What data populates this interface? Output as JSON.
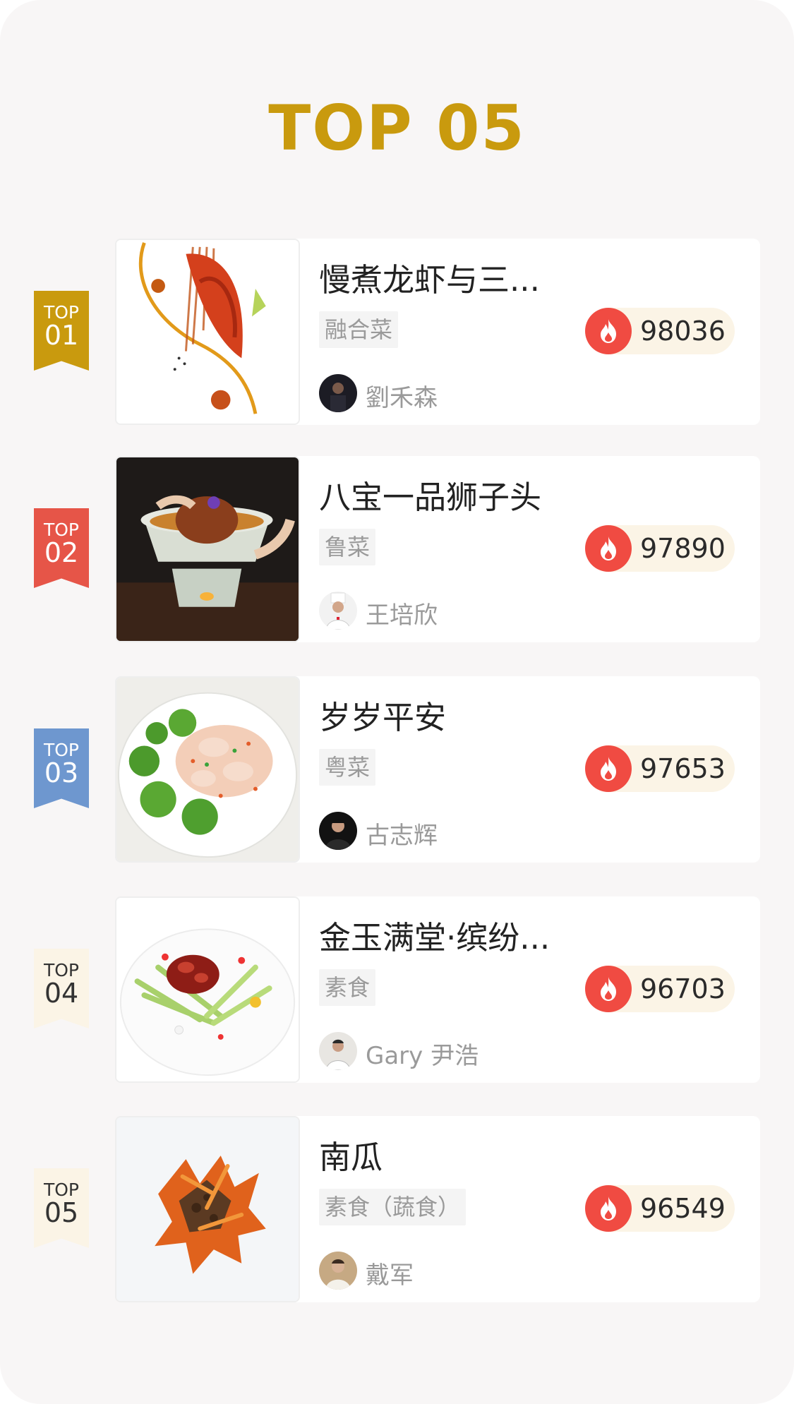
{
  "title": "TOP 05",
  "items": [
    {
      "rank_label": "TOP",
      "rank_no": "01",
      "ribbon_bg": "#c99a0e",
      "ribbon_fg": "#ffffff",
      "dish": "慢煮龙虾与三...",
      "cuisine": "融合菜",
      "chef": "劉禾森",
      "hot": "98036",
      "image": "lobster-dish-image"
    },
    {
      "rank_label": "TOP",
      "rank_no": "02",
      "ribbon_bg": "#e65548",
      "ribbon_fg": "#ffffff",
      "dish": "八宝一品狮子头",
      "cuisine": "鲁菜",
      "chef": "王培欣",
      "hot": "97890",
      "image": "lions-head-meatball-image"
    },
    {
      "rank_label": "TOP",
      "rank_no": "03",
      "ribbon_bg": "#6e97cf",
      "ribbon_fg": "#ffffff",
      "dish": "岁岁平安",
      "cuisine": "粤菜",
      "chef": "古志辉",
      "hot": "97653",
      "image": "shrimp-broccoli-image"
    },
    {
      "rank_label": "TOP",
      "rank_no": "04",
      "ribbon_bg": "#fbf4e6",
      "ribbon_fg": "#333333",
      "dish": "金玉满堂·缤纷...",
      "cuisine": "素食",
      "chef": "Gary 尹浩",
      "hot": "96703",
      "image": "jelly-vegetable-image"
    },
    {
      "rank_label": "TOP",
      "rank_no": "05",
      "ribbon_bg": "#fbf4e6",
      "ribbon_fg": "#333333",
      "dish": "南瓜",
      "cuisine": "素食（蔬食）",
      "chef": "戴军",
      "hot": "96549",
      "image": "pumpkin-dish-image"
    }
  ],
  "colors": {
    "title": "#c99a0e",
    "fire": "#f04b42",
    "hot_pill": "#fbf4e6",
    "background": "#f8f6f6"
  },
  "icons": {
    "hot": "fire-icon"
  }
}
